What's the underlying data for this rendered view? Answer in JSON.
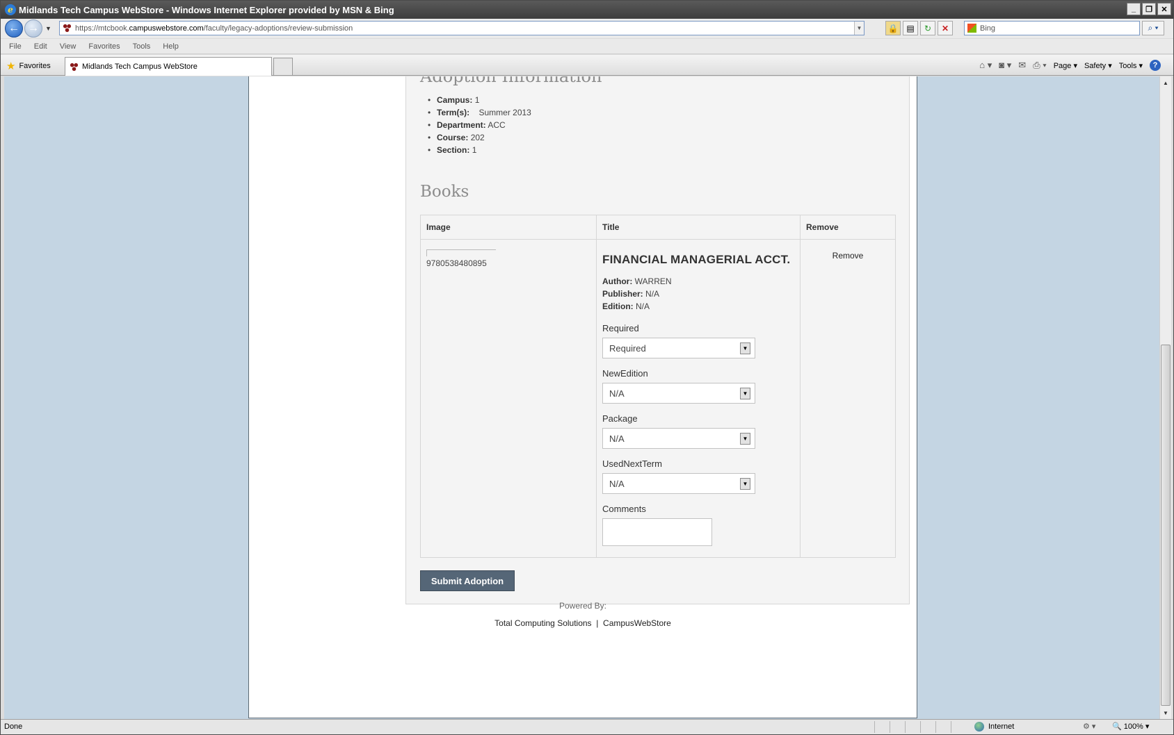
{
  "window": {
    "title": "Midlands Tech Campus WebStore - Windows Internet Explorer provided by MSN & Bing"
  },
  "address": {
    "url_prefix": "https://mtcbook.",
    "url_domain": "campuswebstore.com",
    "url_path": "/faculty/legacy-adoptions/review-submission",
    "search_placeholder": "Bing"
  },
  "menu": [
    "File",
    "Edit",
    "View",
    "Favorites",
    "Tools",
    "Help"
  ],
  "favorites_bar": {
    "favorites_label": "Favorites",
    "tab_title": "Midlands Tech Campus WebStore",
    "page_label": "Page",
    "safety_label": "Safety",
    "tools_label": "Tools"
  },
  "adoption": {
    "heading": "Adoption Information",
    "items": [
      {
        "label": "Campus:",
        "value": "1"
      },
      {
        "label": "Term(s):",
        "value": "Summer 2013"
      },
      {
        "label": "Department:",
        "value": "ACC"
      },
      {
        "label": "Course:",
        "value": "202"
      },
      {
        "label": "Section:",
        "value": "1"
      }
    ]
  },
  "books": {
    "heading": "Books",
    "columns": [
      "Image",
      "Title",
      "Remove"
    ],
    "rows": [
      {
        "isbn": "9780538480895",
        "title": "FINANCIAL MANAGERIAL ACCT.",
        "author_label": "Author:",
        "author": "WARREN",
        "publisher_label": "Publisher:",
        "publisher": "N/A",
        "edition_label": "Edition:",
        "edition": "N/A",
        "fields": [
          {
            "label": "Required",
            "value": "Required"
          },
          {
            "label": "NewEdition",
            "value": "N/A"
          },
          {
            "label": "Package",
            "value": "N/A"
          },
          {
            "label": "UsedNextTerm",
            "value": "N/A"
          }
        ],
        "comments_label": "Comments",
        "remove_label": "Remove"
      }
    ]
  },
  "submit_label": "Submit Adoption",
  "footer": {
    "powered_by": "Powered By:",
    "link1": "Total Computing Solutions",
    "separator": "|",
    "link2": "CampusWebStore"
  },
  "status": {
    "text": "Done",
    "zone": "Internet",
    "zoom": "100%"
  }
}
